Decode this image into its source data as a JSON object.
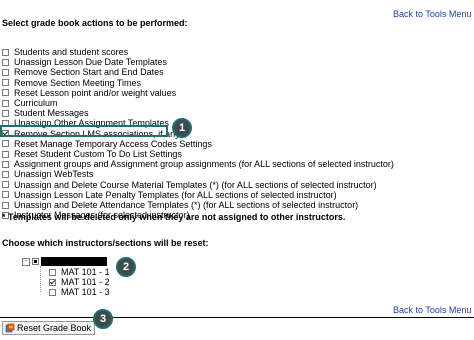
{
  "header": {
    "back_link": "Back to Tools Menu",
    "title": "Select grade book actions to be performed:"
  },
  "options": [
    {
      "label": "Students and student scores",
      "checked": false
    },
    {
      "label": "Unassign Lesson Due Date Templates",
      "checked": false
    },
    {
      "label": "Remove Section Start and End Dates",
      "checked": false
    },
    {
      "label": "Remove Section Meeting Times",
      "checked": false
    },
    {
      "label": "Reset Lesson point and/or weight values",
      "checked": false
    },
    {
      "label": "Curriculum",
      "checked": false
    },
    {
      "label": "Student Messages",
      "checked": false
    },
    {
      "label": "Unassign Other Assignment Templates",
      "checked": false
    },
    {
      "label": "Remove Section LMS associations, if any",
      "checked": true
    },
    {
      "label": "Reset Manage Temporary Access Codes Settings",
      "checked": false
    },
    {
      "label": "Reset Student Custom To Do List Settings",
      "checked": false
    },
    {
      "label": "Assignment groups and Assignment group assignments (for ALL sections of selected instructor)",
      "checked": false
    },
    {
      "label": "Unassign WebTests",
      "checked": false
    },
    {
      "label": "Unassign and Delete Course Material Templates (*) (for ALL sections of selected instructor)",
      "checked": false
    },
    {
      "label": "Unassign Lesson Late Penalty Templates (for ALL sections of selected instructor)",
      "checked": false
    },
    {
      "label": "Unassign and Delete Attendance Templates (*) (for ALL sections of selected instructor)",
      "checked": false
    },
    {
      "label": "Instructor Messages (for selected instructor)",
      "checked": false
    }
  ],
  "templates_note": "* Templates will be deleted only when they are not assigned to other instructors.",
  "instructors": {
    "heading": "Choose which instructors/sections will be reset:",
    "tree_toggle": "−",
    "sections": [
      {
        "label": "MAT 101 - 1",
        "checked": false
      },
      {
        "label": "MAT 101 - 2",
        "checked": true
      },
      {
        "label": "MAT 101 - 3",
        "checked": false
      }
    ]
  },
  "footer": {
    "back_link": "Back to Tools Menu",
    "reset_button": "Reset Grade Book"
  },
  "callouts": [
    "1",
    "2",
    "3"
  ],
  "colors": {
    "link": "#1f3f9e",
    "callout_fill": "#3f4a4d",
    "callout_border": "#1f6f73"
  },
  "icons": [
    "reset-gradebook-icon"
  ]
}
